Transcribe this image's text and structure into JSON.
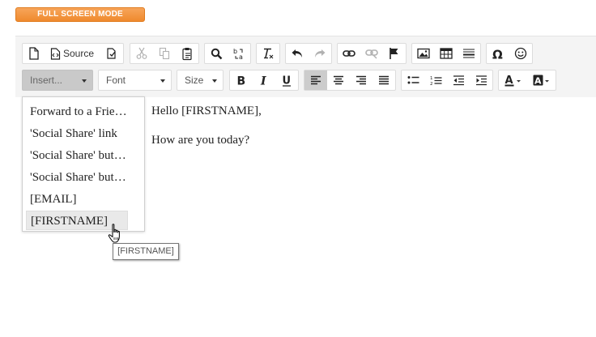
{
  "fullscreen_button": {
    "label": "FULL SCREEN MODE",
    "color": "#f39a47"
  },
  "toolbar": {
    "source_label": "Source",
    "insert_combo": {
      "selected": "Insert..."
    },
    "font_combo": {
      "selected": "Font"
    },
    "size_combo": {
      "selected": "Size"
    },
    "icons": [
      "new-page-icon",
      "source-icon",
      "templates-icon",
      "cut-icon",
      "copy-icon",
      "paste-icon",
      "find-icon",
      "replace-icon",
      "remove-format-icon",
      "undo-icon",
      "redo-icon",
      "link-icon",
      "unlink-icon",
      "anchor-flag-icon",
      "image-icon",
      "table-icon",
      "horizontal-rule-icon",
      "special-char-icon",
      "smiley-icon",
      "bold-icon",
      "italic-icon",
      "underline-icon",
      "align-left-icon",
      "align-center-icon",
      "align-right-icon",
      "justify-icon",
      "bulleted-list-icon",
      "numbered-list-icon",
      "decrease-indent-icon",
      "increase-indent-icon",
      "text-color-icon",
      "background-color-icon"
    ]
  },
  "insert_dropdown": {
    "items": [
      {
        "label": "Forward to a Friend link"
      },
      {
        "label": "'Social Share' link"
      },
      {
        "label": "'Social Share' buttons"
      },
      {
        "label": "'Social Share' buttons"
      },
      {
        "label": "[EMAIL]"
      },
      {
        "label": "[FIRSTNAME]"
      }
    ],
    "hovered_index": 5
  },
  "tooltip": {
    "text": "[FIRSTNAME]"
  },
  "content": {
    "line1": "Hello [FIRSTNAME],",
    "line2": "How are you today?"
  }
}
